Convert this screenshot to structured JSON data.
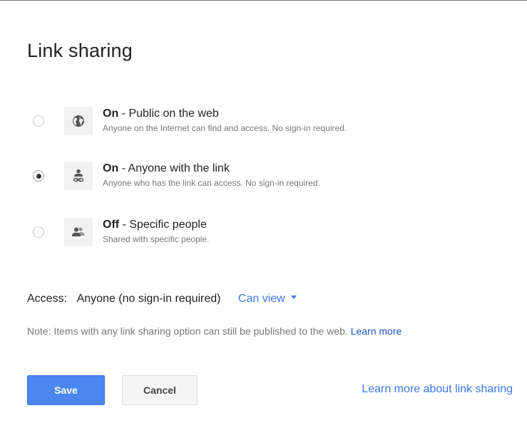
{
  "dialog": {
    "title": "Link sharing"
  },
  "options": [
    {
      "state": "On",
      "label": " - Public on the web",
      "description": "Anyone on the Internet can find and access. No sign-in required.",
      "icon": "globe-icon",
      "selected": false
    },
    {
      "state": "On",
      "label": " - Anyone with the link",
      "description": "Anyone who has the link can access. No sign-in required.",
      "icon": "person-link-icon",
      "selected": true
    },
    {
      "state": "Off",
      "label": " - Specific people",
      "description": "Shared with specific people.",
      "icon": "people-icon",
      "selected": false
    }
  ],
  "access": {
    "label": "Access:",
    "value": "Anyone (no sign-in required)",
    "permission": "Can view"
  },
  "note": {
    "text": "Note: Items with any link sharing option can still be published to the web. ",
    "link": "Learn more"
  },
  "buttons": {
    "save": "Save",
    "cancel": "Cancel"
  },
  "footer": {
    "learn_more": "Learn more about link sharing"
  },
  "colors": {
    "accent": "#4a87ee",
    "link": "#3b78e7",
    "muted_text": "#777777"
  }
}
